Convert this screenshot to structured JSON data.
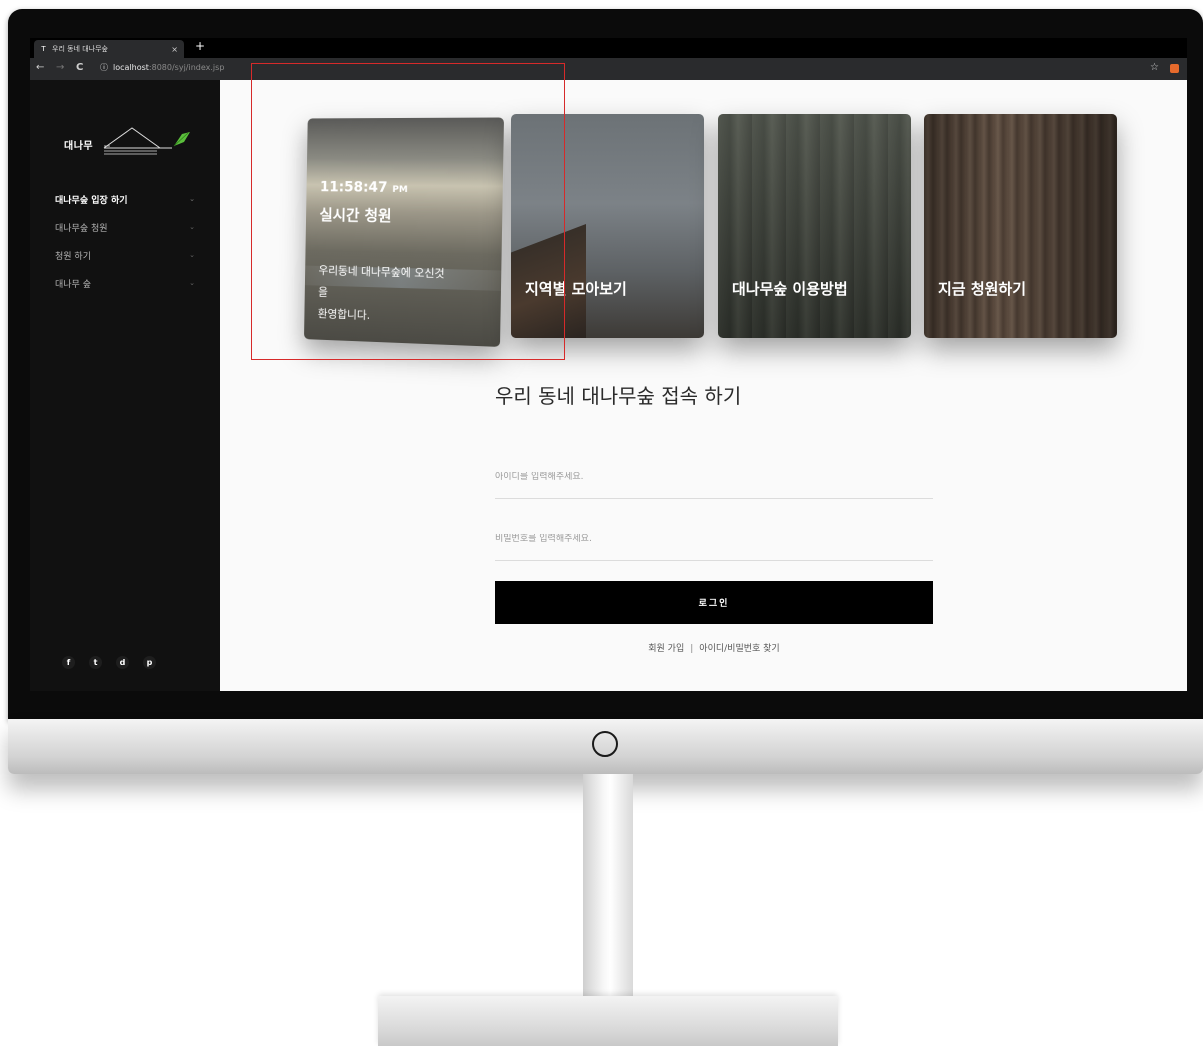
{
  "browser": {
    "tab_title": "우리 동네 대나무숲",
    "favicon": "T",
    "close_glyph": "×",
    "new_tab_glyph": "+",
    "url_host": "localhost",
    "url_path": ":8080/syj/index.jsp",
    "back_glyph": "←",
    "forward_glyph": "→",
    "reload_glyph": "C",
    "info_glyph": "ⓘ",
    "star_glyph": "☆"
  },
  "sidebar": {
    "logo_text": "대나무",
    "items": [
      {
        "label": "대나무숲 입장 하기"
      },
      {
        "label": "대나무숲 청원"
      },
      {
        "label": "청원 하기"
      },
      {
        "label": "대나무 숲"
      }
    ],
    "chevron": "⌄",
    "socials": [
      "f",
      "t",
      "d",
      "p"
    ]
  },
  "cards": {
    "realtime": {
      "time": "11:58:47",
      "meridiem": "PM",
      "title": "실시간 청원",
      "welcome_line1": "우리동네 대나무숲에 오신것",
      "welcome_line2": "을",
      "welcome_line3": "환영합니다."
    },
    "regions": {
      "label": "지역별 모아보기"
    },
    "howto": {
      "label": "대나무숲 이용방법"
    },
    "petition": {
      "label": "지금 청원하기"
    }
  },
  "login": {
    "heading": "우리 동네 대나무숲 접속 하기",
    "id_placeholder": "아이디를 입력해주세요.",
    "pw_placeholder": "비밀번호를 입력해주세요.",
    "button_label": "로그인",
    "signup_link": "회원 가입",
    "separator": "|",
    "find_link": "아이디/비밀번호 찾기"
  },
  "colors": {
    "highlight": "#d62a2a",
    "button_bg": "#000000",
    "sidebar_bg": "#111111",
    "logo_leaf": "#5bbf3c"
  },
  "icons": {
    "back": "arrow-left-icon",
    "forward": "arrow-right-icon",
    "reload": "reload-icon",
    "info": "info-icon",
    "star": "star-icon",
    "socials": [
      "facebook-icon",
      "twitter-icon",
      "dribbble-icon",
      "pinterest-icon"
    ]
  }
}
